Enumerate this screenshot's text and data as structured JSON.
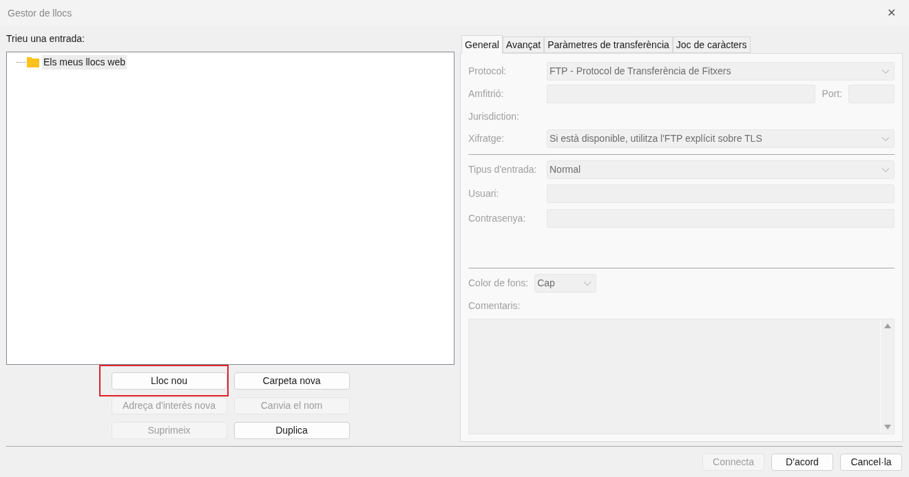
{
  "window": {
    "title": "Gestor de llocs",
    "close": "✕"
  },
  "left": {
    "label": "Trieu una entrada:",
    "tree": [
      {
        "label": "Els meus llocs web",
        "selected": true
      }
    ],
    "buttons": [
      {
        "label": "Lloc nou",
        "disabled": false,
        "highlighted": true
      },
      {
        "label": "Carpeta nova",
        "disabled": false,
        "highlighted": false
      },
      {
        "label": "Adreça d'interès nova",
        "disabled": true,
        "highlighted": false
      },
      {
        "label": "Canvia el nom",
        "disabled": true,
        "highlighted": false
      },
      {
        "label": "Suprimeix",
        "disabled": true,
        "highlighted": false
      },
      {
        "label": "Duplica",
        "disabled": false,
        "highlighted": false
      }
    ]
  },
  "tabs": [
    {
      "label": "General",
      "selected": true
    },
    {
      "label": "Avançat",
      "selected": false
    },
    {
      "label": "Paràmetres de transferència",
      "selected": false
    },
    {
      "label": "Joc de caràcters",
      "selected": false
    }
  ],
  "form": {
    "disabled": true,
    "rows": [
      {
        "kind": "select",
        "label": "Protocol:",
        "value": "FTP - Protocol de Transferència de Fitxers"
      },
      {
        "kind": "host",
        "label": "Amfitrió:",
        "port_label": "Port:"
      },
      {
        "kind": "text",
        "label": "Jurisdiction:"
      },
      {
        "kind": "select",
        "label": "Xifratge:",
        "value": "Si està disponible, utilitza l'FTP explícit sobre TLS"
      },
      {
        "kind": "divider"
      },
      {
        "kind": "select",
        "label": "Tipus d'entrada:",
        "value": "Normal"
      },
      {
        "kind": "input",
        "label": "Usuari:"
      },
      {
        "kind": "input",
        "label": "Contrasenya:"
      },
      {
        "kind": "spacer"
      },
      {
        "kind": "divider"
      },
      {
        "kind": "small_select",
        "label": "Color de fons:",
        "value": "Cap"
      },
      {
        "kind": "text",
        "label": "Comentaris:"
      },
      {
        "kind": "textarea"
      }
    ]
  },
  "footer": [
    {
      "label": "Connecta",
      "disabled": true
    },
    {
      "label": "D'acord",
      "disabled": false
    },
    {
      "label": "Cancel·la",
      "disabled": false
    }
  ]
}
